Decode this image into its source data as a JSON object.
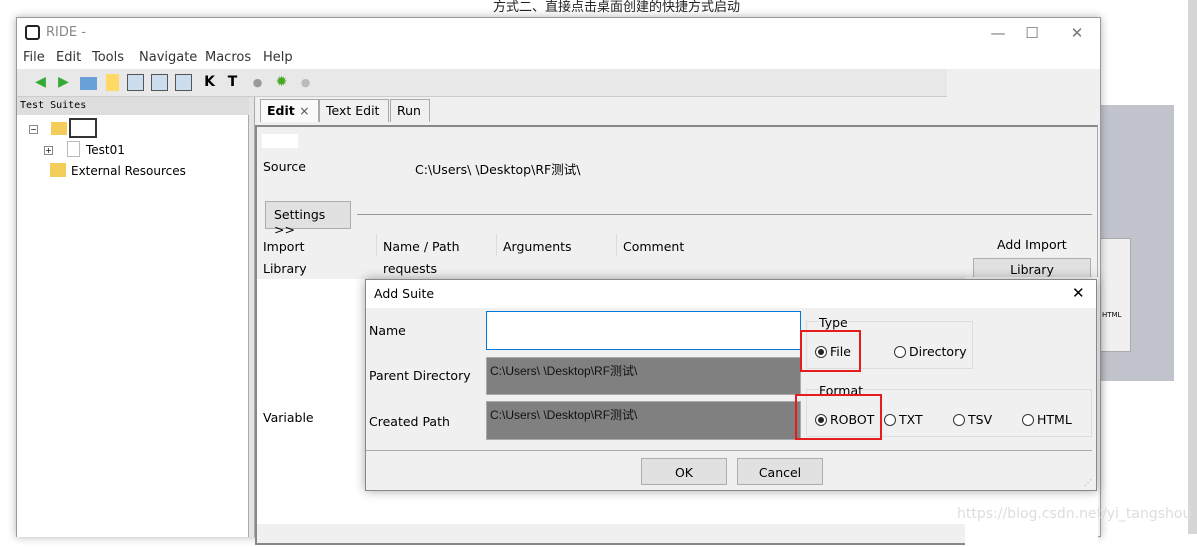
{
  "doc_text": "方式二、直接点击桌面创建的快捷方式启动",
  "window": {
    "title": "RIDE - ",
    "controls": {
      "minimize": "—",
      "maximize": "☐",
      "close": "✕"
    }
  },
  "menu": [
    "File",
    "Edit",
    "Tools",
    "Navigate",
    "Macros",
    "Help"
  ],
  "toolbar": {
    "icons": [
      "back-icon",
      "forward-icon",
      "open-icon",
      "new-icon",
      "save-icon",
      "save-all-icon",
      "save-as-icon",
      "keyword-search-icon",
      "test-search-icon",
      "run-icon",
      "debug-icon",
      "stop-icon"
    ],
    "k_label": "K",
    "t_label": "T"
  },
  "tree": {
    "header": "Test Suites",
    "items": [
      "Test01",
      "External Resources"
    ]
  },
  "tabs": [
    {
      "label": "Edit",
      "close": "×"
    },
    {
      "label": "Text Edit"
    },
    {
      "label": "Run"
    }
  ],
  "editor": {
    "source_label": "Source",
    "source_value": "C:\\Users\\       \\Desktop\\RF测试\\",
    "settings_button": "Settings >>",
    "columns": [
      "Import",
      "Name / Path",
      "Arguments",
      "Comment"
    ],
    "rows": [
      [
        "Library",
        "requests",
        "",
        ""
      ]
    ],
    "variable_label": "Variable",
    "add_import_label": "Add Import",
    "library_button": "Library"
  },
  "dialog": {
    "title": "Add Suite",
    "close": "✕",
    "name_label": "Name",
    "name_value": "",
    "parent_label": "Parent Directory",
    "parent_value": "C:\\Users\\       \\Desktop\\RF测试\\",
    "created_label": "Created Path",
    "created_value": "C:\\Users\\       \\Desktop\\RF测试\\",
    "type_label": "Type",
    "type_options": [
      "File",
      "Directory"
    ],
    "type_selected": "File",
    "format_label": "Format",
    "format_options": [
      "ROBOT",
      "TXT",
      "TSV",
      "HTML"
    ],
    "format_selected": "ROBOT",
    "ok": "OK",
    "cancel": "Cancel",
    "highlight_color": "#e51c1c"
  },
  "bg_dialog_text": "HTML",
  "watermark": "https://blog.csdn.net/yi_tangshou"
}
